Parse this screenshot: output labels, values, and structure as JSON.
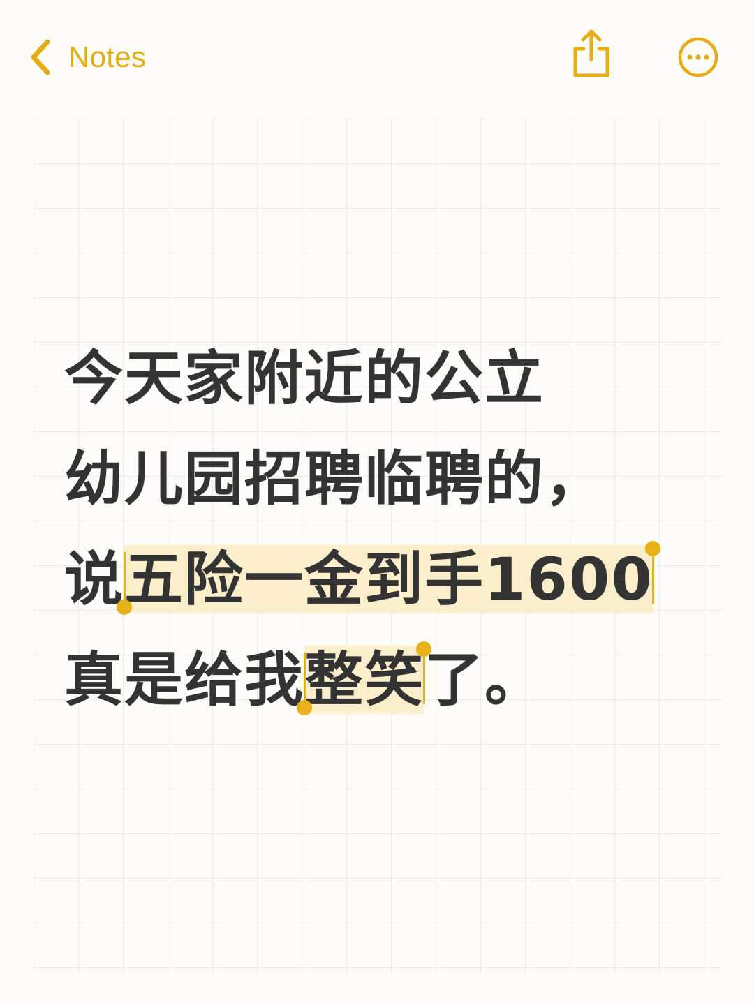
{
  "header": {
    "back_label": "Notes",
    "accent_color": "#e5ad11",
    "back_icon": "chevron-left-icon",
    "share_icon": "share-icon",
    "more_icon": "more-icon"
  },
  "note": {
    "line1": "今天家附近的公立",
    "line2": "幼儿园招聘临聘的，",
    "line3_pre": "说",
    "line3_sel": "五险一金到手1600",
    "line4_pre": "真是给我",
    "line4_sel": "整笑",
    "line4_post": "了。",
    "text_color": "#333333",
    "highlight_color": "#fbeecb"
  }
}
